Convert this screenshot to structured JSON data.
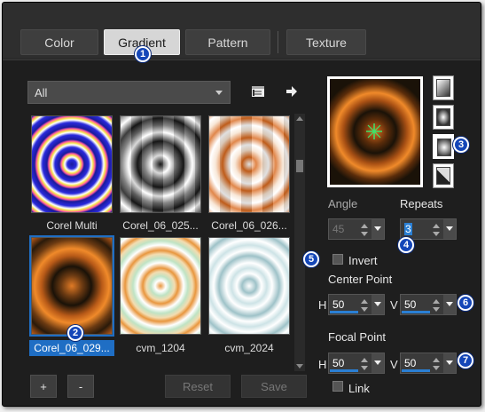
{
  "tabs": [
    {
      "label": "Color"
    },
    {
      "label": "Gradient"
    },
    {
      "label": "Pattern"
    },
    {
      "label": "Texture"
    }
  ],
  "category_dropdown": {
    "value": "All"
  },
  "thumbnails": [
    {
      "label": "Corel Multi"
    },
    {
      "label": "Corel_06_025..."
    },
    {
      "label": "Corel_06_026..."
    },
    {
      "label": "Corel_06_029..."
    },
    {
      "label": "cvm_1204"
    },
    {
      "label": "cvm_2024"
    }
  ],
  "buttons": {
    "add": "+",
    "remove": "-",
    "reset": "Reset",
    "save": "Save"
  },
  "angle": {
    "label": "Angle",
    "value": "45"
  },
  "repeats": {
    "label": "Repeats",
    "value": "3"
  },
  "invert": {
    "label": "Invert"
  },
  "center_point": {
    "label": "Center Point",
    "h_label": "H",
    "h_value": "50",
    "v_label": "V",
    "v_value": "50"
  },
  "focal_point": {
    "label": "Focal Point",
    "h_label": "H",
    "h_value": "50",
    "v_label": "V",
    "v_value": "50"
  },
  "link": {
    "label": "Link"
  },
  "callouts": [
    "1",
    "2",
    "3",
    "4",
    "5",
    "6",
    "7"
  ],
  "colors": {
    "accent": "#1f6ec4",
    "callout": "#1446b8",
    "orange": "#d9691e"
  }
}
